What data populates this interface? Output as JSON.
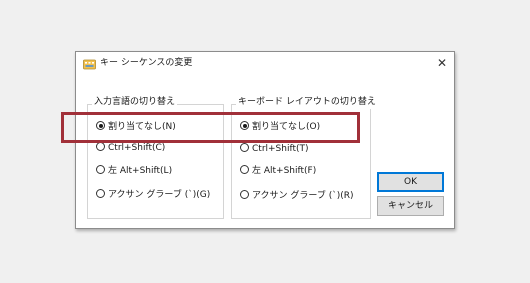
{
  "dialog": {
    "title": "キー シーケンスの変更",
    "close_symbol": "✕"
  },
  "input_language_group": {
    "legend": "入力言語の切り替え",
    "options": [
      {
        "label": "割り当てなし(N)",
        "selected": true
      },
      {
        "label": "Ctrl+Shift(C)",
        "selected": false
      },
      {
        "label": "左 Alt+Shift(L)",
        "selected": false
      },
      {
        "label": "アクサン グラーブ (`)(G)",
        "selected": false
      }
    ]
  },
  "keyboard_layout_group": {
    "legend": "キーボード レイアウトの切り替え",
    "options": [
      {
        "label": "割り当てなし(O)",
        "selected": true
      },
      {
        "label": "Ctrl+Shift(T)",
        "selected": false
      },
      {
        "label": "左 Alt+Shift(F)",
        "selected": false
      },
      {
        "label": "アクサン グラーブ (`)(R)",
        "selected": false
      }
    ]
  },
  "buttons": {
    "ok_label": "OK",
    "cancel_label": "キャンセル"
  },
  "colors": {
    "highlight": "#a13039",
    "default_button_border": "#0078d7"
  }
}
